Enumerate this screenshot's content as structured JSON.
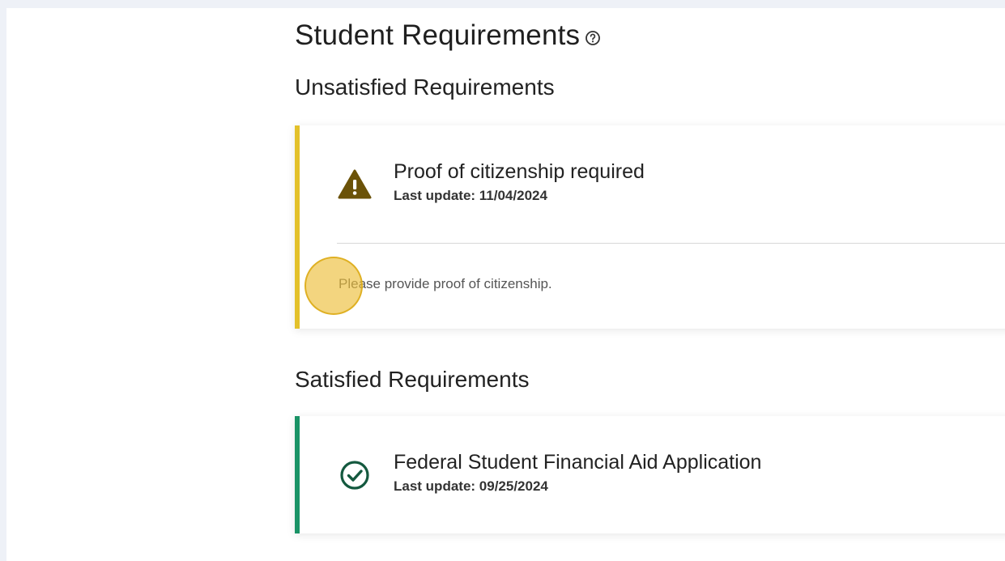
{
  "page": {
    "title": "Student Requirements",
    "help_icon": "help-circle-icon"
  },
  "unsatisfied": {
    "heading": "Unsatisfied Requirements",
    "accent_color": "#e3c12b",
    "items": [
      {
        "icon": "warning-triangle-icon",
        "title": "Proof of citizenship required",
        "last_update": "Last update: 11/04/2024",
        "description": "Please provide proof of citizenship."
      }
    ]
  },
  "satisfied": {
    "heading": "Satisfied Requirements",
    "accent_color": "#1a9366",
    "items": [
      {
        "icon": "check-circle-icon",
        "title": "Federal Student Financial Aid Application",
        "last_update": "Last update: 09/25/2024"
      }
    ]
  },
  "click_marker_color": "#ecbe3a"
}
